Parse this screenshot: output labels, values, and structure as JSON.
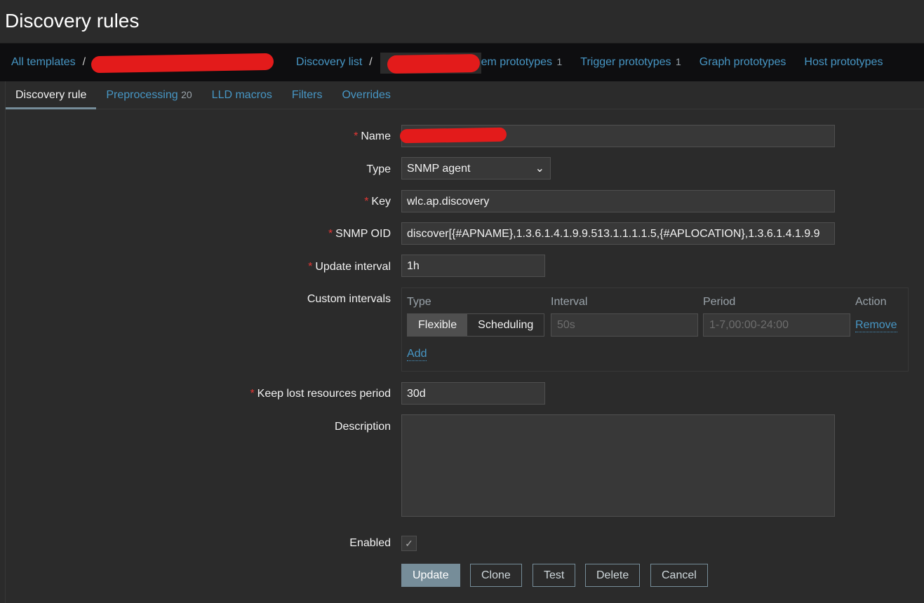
{
  "page_title": "Discovery rules",
  "breadcrumb": {
    "all_templates": "All templates",
    "discovery_list": "Discovery list",
    "items": [
      {
        "label": "Item prototypes",
        "count": "1"
      },
      {
        "label": "Trigger prototypes",
        "count": "1"
      },
      {
        "label": "Graph prototypes",
        "count": ""
      },
      {
        "label": "Host prototypes",
        "count": ""
      }
    ]
  },
  "tabs": [
    {
      "label": "Discovery rule",
      "count": ""
    },
    {
      "label": "Preprocessing",
      "count": "20"
    },
    {
      "label": "LLD macros",
      "count": ""
    },
    {
      "label": "Filters",
      "count": ""
    },
    {
      "label": "Overrides",
      "count": ""
    }
  ],
  "form": {
    "name_label": "Name",
    "type_label": "Type",
    "type_value": "SNMP agent",
    "key_label": "Key",
    "key_value": "wlc.ap.discovery",
    "oid_label": "SNMP OID",
    "oid_value": "discover[{#APNAME},1.3.6.1.4.1.9.9.513.1.1.1.1.5,{#APLOCATION},1.3.6.1.4.1.9.9",
    "update_label": "Update interval",
    "update_value": "1h",
    "custom_label": "Custom intervals",
    "custom": {
      "col_type": "Type",
      "col_interval": "Interval",
      "col_period": "Period",
      "col_action": "Action",
      "flexible": "Flexible",
      "scheduling": "Scheduling",
      "interval_placeholder": "50s",
      "period_placeholder": "1-7,00:00-24:00",
      "remove": "Remove",
      "add": "Add"
    },
    "keep_label": "Keep lost resources period",
    "keep_value": "30d",
    "desc_label": "Description",
    "enabled_label": "Enabled",
    "enabled": true
  },
  "buttons": {
    "update": "Update",
    "clone": "Clone",
    "test": "Test",
    "delete": "Delete",
    "cancel": "Cancel"
  },
  "colors": {
    "link": "#4796c4",
    "accent": "#768d99",
    "required": "#e33734"
  }
}
